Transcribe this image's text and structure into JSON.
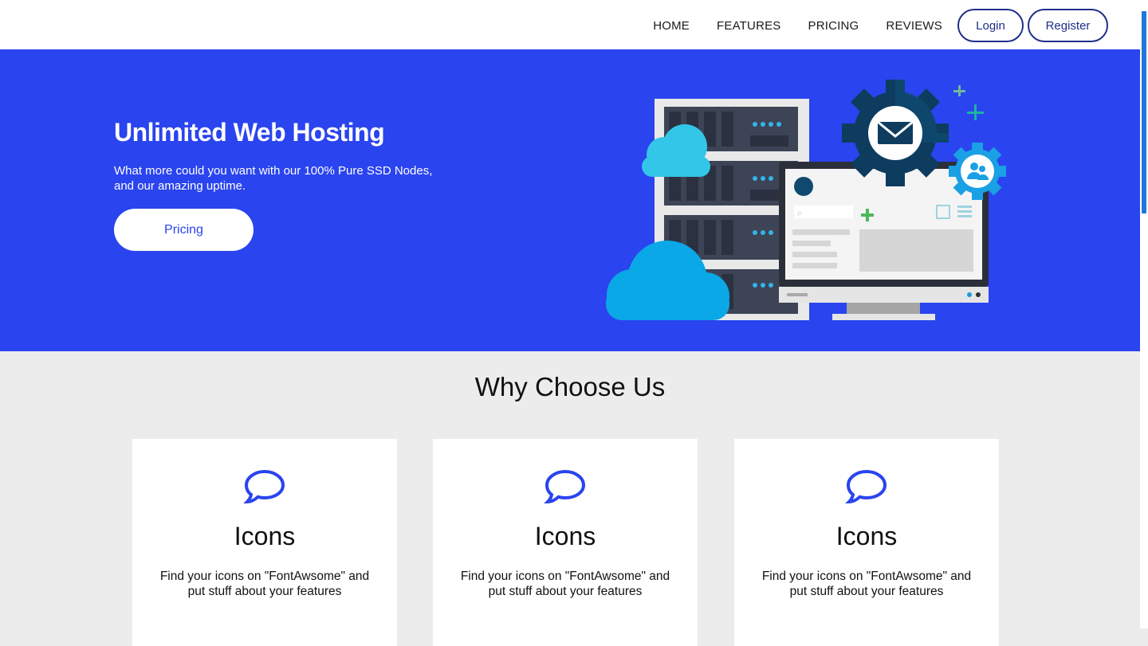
{
  "nav": {
    "links": [
      "HOME",
      "FEATURES",
      "PRICING",
      "REVIEWS"
    ],
    "login_label": "Login",
    "register_label": "Register"
  },
  "hero": {
    "title": "Unlimited Web Hosting",
    "subtitle": "What more could you want with our 100% Pure SSD Nodes, and our amazing uptime.",
    "button_label": "Pricing"
  },
  "why": {
    "title": "Why Choose Us",
    "cards": [
      {
        "icon": "speech-bubble-icon",
        "title": "Icons",
        "text": "Find your icons on \"FontAwsome\" and put stuff about your features"
      },
      {
        "icon": "speech-bubble-icon",
        "title": "Icons",
        "text": "Find your icons on \"FontAwsome\" and put stuff about your features"
      },
      {
        "icon": "speech-bubble-icon",
        "title": "Icons",
        "text": "Find your icons on \"FontAwsome\" and put stuff about your features"
      }
    ]
  },
  "colors": {
    "hero_bg": "#2a44ef",
    "accent": "#2a44ef",
    "nav_button_border": "#1f2f8a",
    "section_bg": "#ececec"
  }
}
